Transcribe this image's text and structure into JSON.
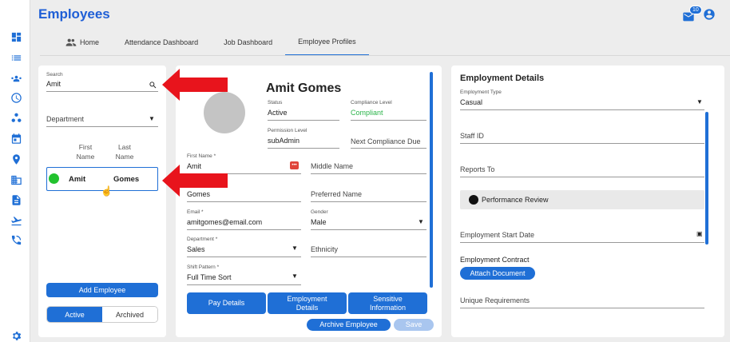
{
  "app": {
    "title": "Employees",
    "mail_badge": "10"
  },
  "tabs": [
    {
      "label": "Home"
    },
    {
      "label": "Attendance Dashboard"
    },
    {
      "label": "Job Dashboard"
    },
    {
      "label": "Employee Profiles"
    }
  ],
  "left": {
    "search_label": "Search",
    "search_value": "Amit",
    "department_placeholder": "Department",
    "col_first": "First Name",
    "col_last": "Last Name",
    "row": {
      "first": "Amit",
      "last": "Gomes"
    },
    "add_employee": "Add Employee",
    "toggle_active": "Active",
    "toggle_archived": "Archived"
  },
  "profile": {
    "name": "Amit Gomes",
    "status_label": "Status",
    "status": "Active",
    "compliance_label": "Compliance Level",
    "compliance": "Compliant",
    "permission_label": "Permission Level",
    "permission": "subAdmin",
    "next_compliance": "Next Compliance Due",
    "first_name_label": "First Name *",
    "first_name": "Amit",
    "middle_name": "Middle Name",
    "last_name": "Gomes",
    "preferred_name": "Preferred Name",
    "email_label": "Email *",
    "email": "amitgomes@email.com",
    "gender_label": "Gender",
    "gender": "Male",
    "department_label": "Department *",
    "department": "Sales",
    "ethnicity": "Ethnicity",
    "shift_label": "Shift Pattern *",
    "shift": "Full Time Sort",
    "btn_pay": "Pay Details",
    "btn_employment": "Employment Details",
    "btn_sensitive": "Sensitive Information",
    "btn_archive": "Archive Employee",
    "btn_save": "Save"
  },
  "employment": {
    "title": "Employment Details",
    "type_label": "Employment Type",
    "type": "Casual",
    "staff_id": "Staff ID",
    "reports_to": "Reports To",
    "performance_review": "Performance Review",
    "start_date": "Employment Start Date",
    "contract_label": "Employment Contract",
    "attach": "Attach Document",
    "unique": "Unique Requirements"
  },
  "colors": {
    "accent": "#1f6fd6",
    "compliant": "#2bb44a",
    "arrow": "#e8141c",
    "online": "#22c22e"
  }
}
